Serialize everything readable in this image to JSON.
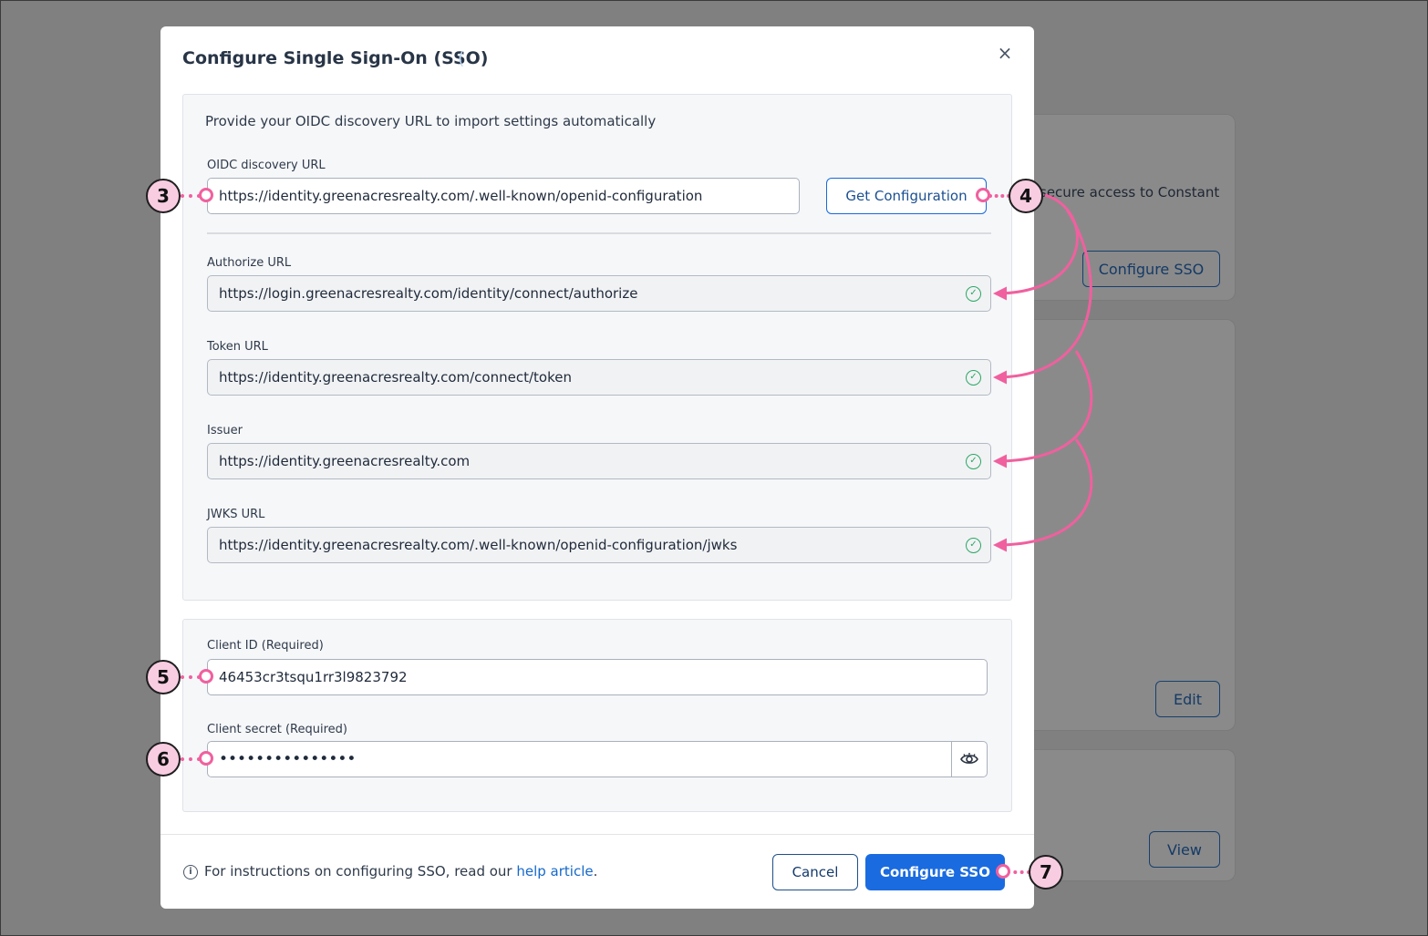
{
  "background": {
    "card1_text": "secure access to Constant",
    "card1_button": "Configure SSO",
    "card2_button": "Edit",
    "card3_button": "View"
  },
  "modal": {
    "title": "Configure Single Sign-On (SSO)",
    "title_suffix": "(",
    "close_icon": "×",
    "discovery": {
      "intro": "Provide your OIDC discovery URL to import settings automatically",
      "url_label": "OIDC discovery URL",
      "url_value": "https://identity.greenacresrealty.com/.well-known/openid-configuration",
      "get_config_label": "Get Configuration"
    },
    "fields": [
      {
        "label": "Authorize URL",
        "value": "https://login.greenacresrealty.com/identity/connect/authorize"
      },
      {
        "label": "Token URL",
        "value": "https://identity.greenacresrealty.com/connect/token"
      },
      {
        "label": "Issuer",
        "value": "https://identity.greenacresrealty.com"
      },
      {
        "label": "JWKS URL",
        "value": "https://identity.greenacresrealty.com/.well-known/openid-configuration/jwks"
      }
    ],
    "check_glyph": "✓",
    "client": {
      "id_label": "Client ID",
      "id_required": "(Required)",
      "id_value": "46453cr3tsqu1rr3l9823792",
      "secret_label": "Client secret",
      "secret_required": "(Required)",
      "secret_value": "•••••••••••••••"
    },
    "footer": {
      "info_glyph": "i",
      "text": "For instructions on configuring SSO, read our ",
      "link": "help article",
      "period": ".",
      "cancel_label": "Cancel",
      "confirm_label": "Configure SSO"
    }
  },
  "annotations": {
    "step3": "3",
    "step4": "4",
    "step5": "5",
    "step6": "6",
    "step7": "7"
  },
  "colors": {
    "accent": "#1a6be0",
    "annotation": "#f0609e",
    "success": "#2aa865"
  }
}
